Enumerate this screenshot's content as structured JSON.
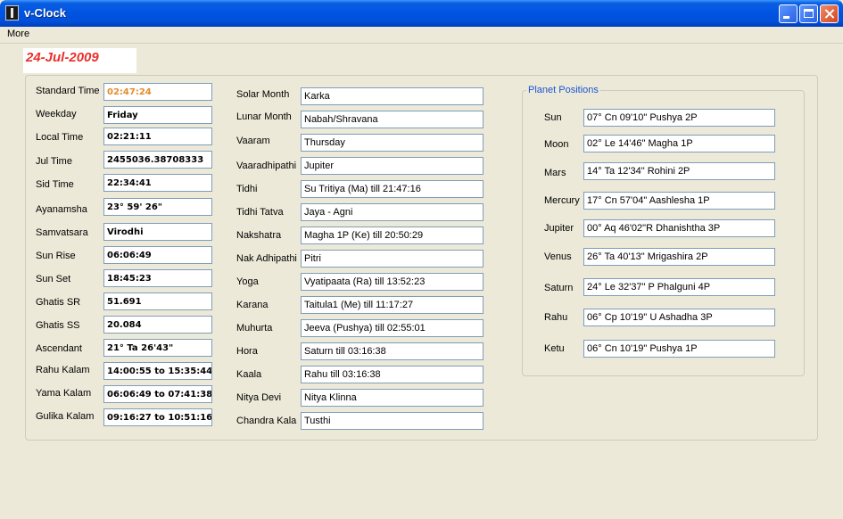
{
  "window": {
    "title": "v-Clock"
  },
  "menu": {
    "more": "More"
  },
  "date": "24-Jul-2009",
  "time_panel": [
    {
      "label": "Standard Time",
      "value": "02:47:24"
    },
    {
      "label": "Weekday",
      "value": "Friday"
    },
    {
      "label": "Local Time",
      "value": "02:21:11"
    },
    {
      "label": "Jul Time",
      "value": "2455036.38708333"
    },
    {
      "label": "Sid Time",
      "value": "22:34:41"
    },
    {
      "label": "Ayanamsha",
      "value": "23° 59' 26\""
    },
    {
      "label": "Samvatsara",
      "value": "Virodhi"
    },
    {
      "label": "Sun Rise",
      "value": "06:06:49"
    },
    {
      "label": "Sun Set",
      "value": "18:45:23"
    },
    {
      "label": "Ghatis SR",
      "value": "51.691"
    },
    {
      "label": "Ghatis SS",
      "value": "20.084"
    },
    {
      "label": "Ascendant",
      "value": "21° Ta 26'43\""
    },
    {
      "label": "Rahu Kalam",
      "value": "14:00:55 to 15:35:44"
    },
    {
      "label": "Yama Kalam",
      "value": "06:06:49 to 07:41:38"
    },
    {
      "label": "Gulika Kalam",
      "value": "09:16:27 to 10:51:16"
    }
  ],
  "panchang_panel": [
    {
      "label": "Solar Month",
      "value": "Karka"
    },
    {
      "label": "Lunar Month",
      "value": "Nabah/Shravana"
    },
    {
      "label": "Vaaram",
      "value": "Thursday"
    },
    {
      "label": "Vaaradhipathi",
      "value": "Jupiter"
    },
    {
      "label": "Tidhi",
      "value": "Su Tritiya (Ma) till 21:47:16"
    },
    {
      "label": "Tidhi Tatva",
      "value": "Jaya - Agni"
    },
    {
      "label": "Nakshatra",
      "value": "Magha  1P (Ke) till 20:50:29"
    },
    {
      "label": "Nak Adhipathi",
      "value": "Pitri"
    },
    {
      "label": "Yoga",
      "value": "Vyatipaata (Ra) till 13:52:23"
    },
    {
      "label": "Karana",
      "value": "Taitula1 (Me) till 11:17:27"
    },
    {
      "label": "Muhurta",
      "value": "Jeeva (Pushya) till 02:55:01"
    },
    {
      "label": "Hora",
      "value": "Saturn till 03:16:38"
    },
    {
      "label": "Kaala",
      "value": "Rahu till 03:16:38"
    },
    {
      "label": "Nitya Devi",
      "value": "Nitya Klinna"
    },
    {
      "label": "Chandra Kala",
      "value": "Tusthi"
    }
  ],
  "planet_positions": {
    "title": "Planet Positions",
    "items": [
      {
        "label": "Sun",
        "value": "07° Cn 09'10\"  Pushya  2P"
      },
      {
        "label": "Moon",
        "value": "02° Le 14'46\"  Magha  1P"
      },
      {
        "label": "Mars",
        "value": "14° Ta 12'34\"  Rohini  2P"
      },
      {
        "label": "Mercury",
        "value": "17° Cn 57'04\"  Aashlesha  1P"
      },
      {
        "label": "Jupiter",
        "value": "00° Aq 46'02\"R  Dhanishtha  3P"
      },
      {
        "label": "Venus",
        "value": "26° Ta 40'13\"  Mrigashira  2P"
      },
      {
        "label": "Saturn",
        "value": "24° Le 32'37\"  P Phalguni  4P"
      },
      {
        "label": "Rahu",
        "value": "06° Cp 10'19\"  U Ashadha  3P"
      },
      {
        "label": "Ketu",
        "value": "06° Cn 10'19\"  Pushya  1P"
      }
    ]
  }
}
